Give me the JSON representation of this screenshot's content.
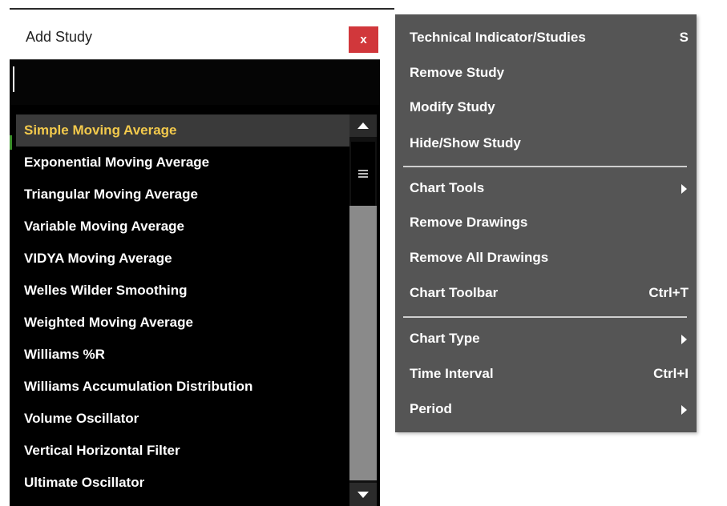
{
  "dialog": {
    "title": "Add Study",
    "close_label": "x",
    "search_value": "",
    "items": [
      "Simple Moving Average",
      "Exponential Moving Average",
      "Triangular Moving Average",
      "Variable Moving Average",
      "VIDYA Moving Average",
      "Welles Wilder Smoothing",
      "Weighted Moving Average",
      "Williams %R",
      "Williams Accumulation Distribution",
      "Volume Oscillator",
      "Vertical Horizontal Filter",
      "Ultimate Oscillator"
    ],
    "selected_index": 0
  },
  "menu": {
    "items": [
      {
        "label": "Technical Indicator/Studies",
        "shortcut": "S"
      },
      {
        "label": "Remove Study"
      },
      {
        "label": "Modify Study"
      },
      {
        "label": "Hide/Show Study"
      },
      {
        "label": "Chart Tools",
        "submenu": true
      },
      {
        "label": "Remove Drawings"
      },
      {
        "label": "Remove All Drawings"
      },
      {
        "label": "Chart Toolbar",
        "shortcut": "Ctrl+T"
      },
      {
        "label": "Chart Type",
        "submenu": true
      },
      {
        "label": "Time Interval",
        "shortcut": "Ctrl+I"
      },
      {
        "label": "Period",
        "submenu": true
      }
    ]
  },
  "colors": {
    "close_button": "#d1373b",
    "selected_text": "#f2c94c",
    "menu_background": "#555555"
  }
}
